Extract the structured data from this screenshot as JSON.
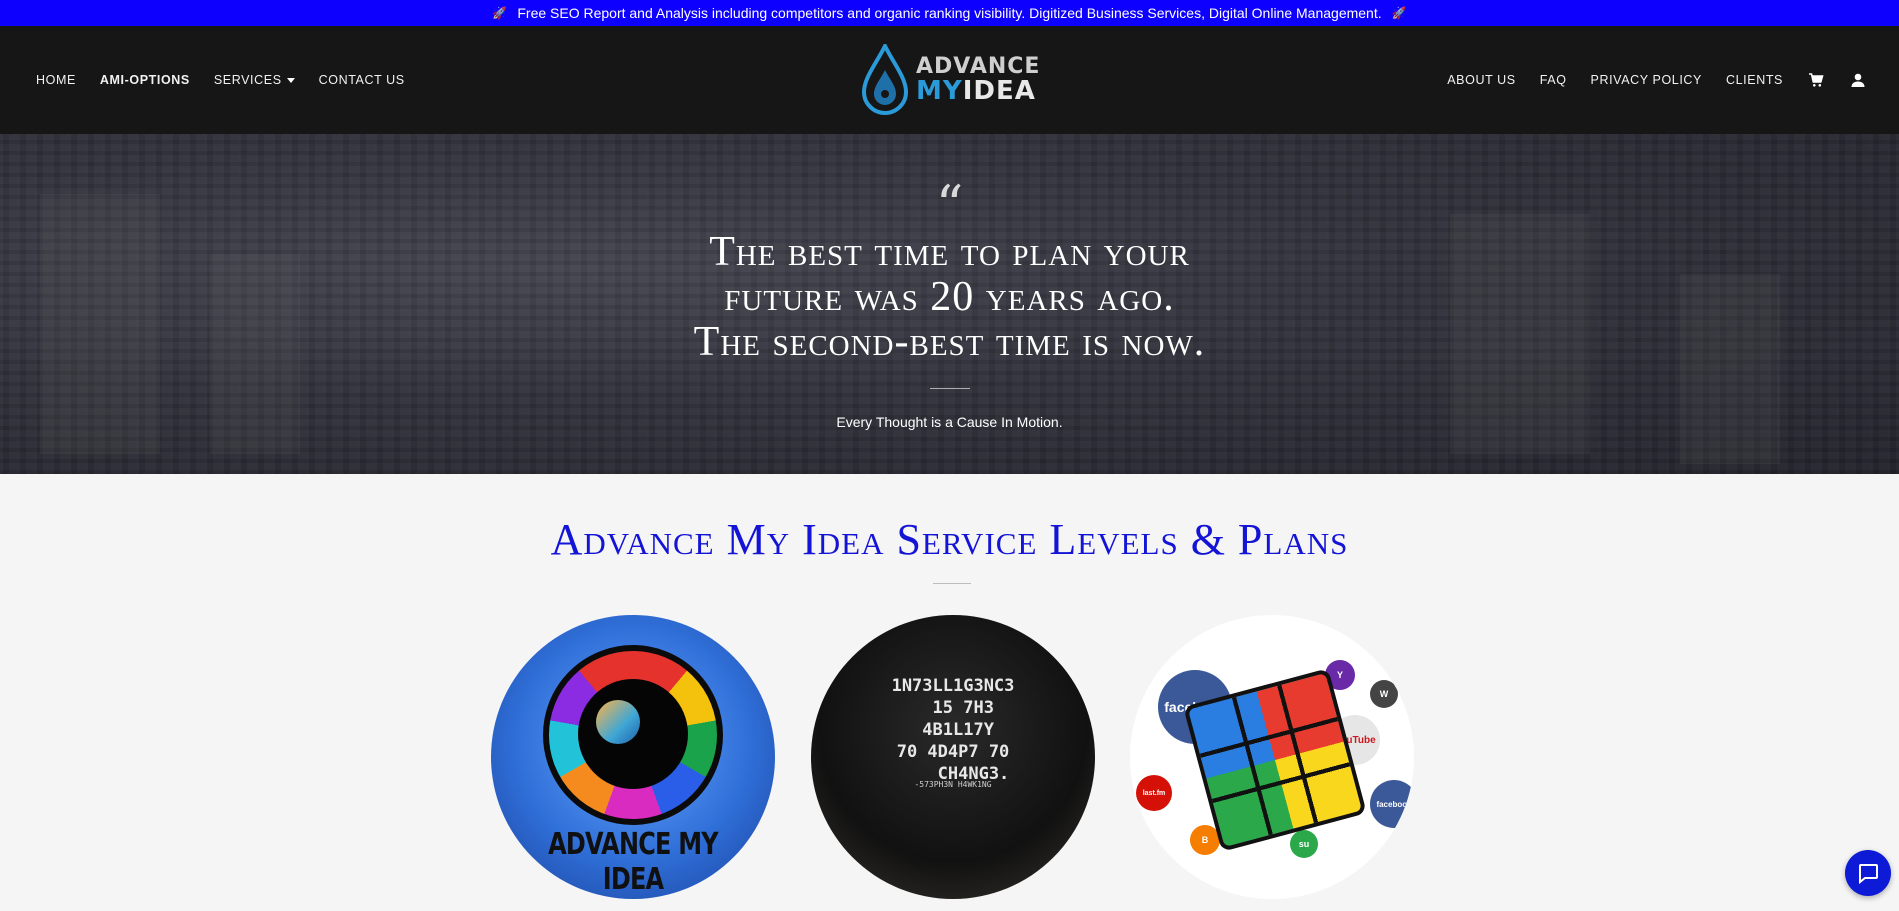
{
  "announcement": {
    "text": "Free SEO Report and Analysis including competitors and organic ranking visibility. Digitized Business Services, Digital Online Management."
  },
  "nav": {
    "left": [
      {
        "label": "HOME"
      },
      {
        "label": "AMI-OPTIONS"
      },
      {
        "label": "SERVICES"
      },
      {
        "label": "CONTACT US"
      }
    ],
    "right": [
      {
        "label": "ABOUT US"
      },
      {
        "label": "FAQ"
      },
      {
        "label": "PRIVACY POLICY"
      },
      {
        "label": "CLIENTS"
      }
    ],
    "icons": [
      "cart-icon",
      "account-icon"
    ]
  },
  "logo": {
    "top": "ADVANCE",
    "bottom_my": "MY",
    "bottom_idea": "IDEA"
  },
  "hero": {
    "quote_mark": "“",
    "quote_line1": "The best time to plan your",
    "quote_line2": "future was 20 years ago.",
    "quote_line3": "The second-best time is now.",
    "tagline": "Every Thought is a Cause In Motion."
  },
  "plans": {
    "title": "Advance My Idea Service Levels & Plans",
    "images": [
      {
        "caption": "ADVANCE MY IDEA"
      },
      {
        "shirt_text": "1N73LL1G3NC3\n  15 7H3\n 4B1L17Y\n70 4D4P7 70\n    CH4NG3.",
        "signature": "-573PH3N H4WK1NG"
      },
      {
        "labels": [
          "facebook",
          "YouTube",
          "facebook",
          "last.fm"
        ]
      }
    ]
  },
  "colors": {
    "announce_bg": "#0d00ff",
    "header_bg": "#161616",
    "title_blue": "#1414d6",
    "chat_fab": "#0d1bd6"
  }
}
